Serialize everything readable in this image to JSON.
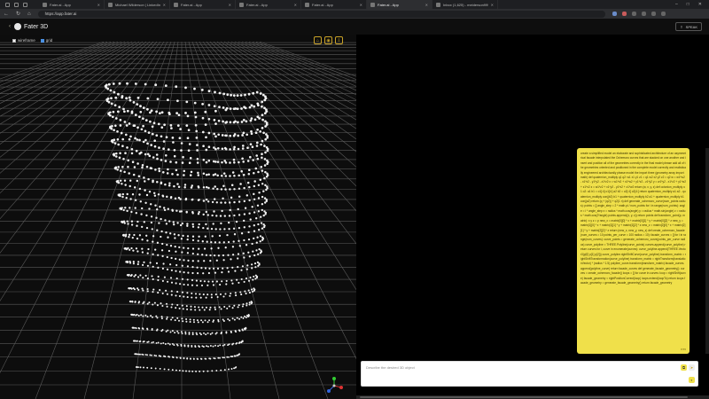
{
  "browser": {
    "tabs": [
      {
        "title": "Fater.ai - App",
        "active": false
      },
      {
        "title": "Michael Wilderson | LinkedIn",
        "active": false
      },
      {
        "title": "Fater.ai - App",
        "active": false
      },
      {
        "title": "Fater.ai - App",
        "active": false
      },
      {
        "title": "Fater.ai - App",
        "active": false
      },
      {
        "title": "Fater.ai - App",
        "active": true
      },
      {
        "title": "Inbox (1,625) - meiderson999@",
        "active": false
      }
    ],
    "url": "https://app.fater.ai"
  },
  "app": {
    "brand": "Fater 3D",
    "share_label": "SPEAK"
  },
  "viewer": {
    "wireframe_label": "wireframe",
    "grid_label": "grid",
    "tool_icons": [
      "home-icon",
      "camera-icon",
      "download-icon"
    ]
  },
  "chat": {
    "message": "create a simplified model an elaborate and sophisticated architecture of an asymmetrical facade interpolated the Ochemoro curves that are stacked on one another and insert and position all of the geometries correctly in the final model please add all of the geometries oriented and positioned in the complete model correctly and realistically engineered architecturally please model the import three (geometry array import math) def quaternion_multiply q1 q2: w1 x1 y1 z1 = q1 w2 x2 y2 z2 = q2 w = w1*w2 - x1*x2 - y1*y2 - z1*z2 x = w1*x2 + x1*w2 + y1*z2 - z1*y2 y = w1*y2 - x1*z2 + y1*w2 + z1*x2 z = w1*z2 + x1*y2 - y1*x2 + z1*w2 return (w, x, y, z) def octonion_multiply o1 o2: a1 b1 = o1[:4] o1[4:] a2 b2 = o2[:4] o2[4:] return quaternion_multiply a1 a2 - quaternion_multiply conj(b2) b1 + quaternion_multiply b2 a1 + quaternion_multiply b1 conj(a2) return (q + (q2)) + q2(1 n) def generate_ochemoro_curve(num_points radius): points = [] angle_step = 2 * math.pi / num_points for i in range(num_points): angle = i * angle_step x = radius * math.cos(angle) y = radius * math.sin(angle) z = radius * math.cos(2*angle) points.append((x, y, z)) return points def transform_point(p, matrix): x y z = p new_x = matrix[0][0] * x + matrix[0][1] * y + matrix[0][2] * z new_y = matrix[1][0] * x + matrix[1][1] * y + matrix[1][2] * z new_z = matrix[2][0] * x + matrix[2][1] * y + matrix[2][2] * z return (new_x, new_y, new_z) def create_ochemoro_facade(num_curves = 10 points_per_curve = 100 radius = 10): facade_curves = [] for i in range(num_curves): curve_points = generate_ochemoro_curve(points_per_curve radius) curve_polyline = THREE.Polyline(curve_points) curves.append(curve_polyline) return curves for i, curve in enumerate(curves): curve_polyline.append(THREE.Vector3(p[0] p[1] p[2])) curve_polyline.rightShiftCurve(curve_polyline) transform_matrix = rightShiftTransformation(curve_polyline) transform_matrix = rightTransform(translationVector) * (radius * 1.5) polyline_curve.transform(transform_matrix) facade_curves.append(polyline_curve) return facade_curves def generate_facade_geometry(): curves = create_ochemoro_facade() loops = [] for curve in curves: loop = rightShift(curve) facade_geometry = rightPositionCorrect(loop) loops.extend(loopTo) return loops facade_geometry = generate_facade_geometry() return facade_geometry",
    "timestamp": "8:55",
    "input_placeholder": "Describe the desired 3D object"
  }
}
